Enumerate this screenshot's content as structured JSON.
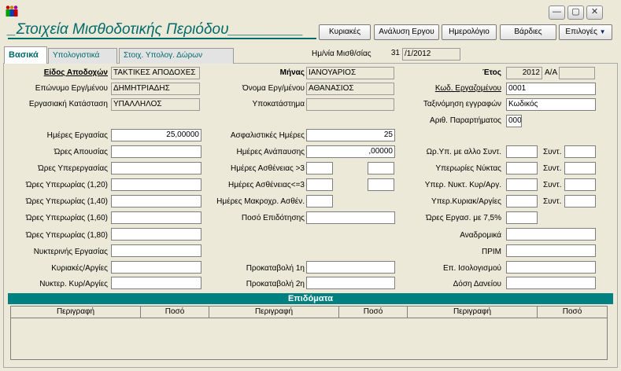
{
  "window": {
    "minimize": "—",
    "maximize": "▢",
    "close": "✕"
  },
  "title": "Στοιχεία Μισθοδοτικής Περιόδου",
  "toolbar": {
    "sundays": "Κυριακές",
    "work_analysis": "Ανάλυση Εργου",
    "calendar": "Ημερολόγιο",
    "shifts": "Βάρδιες",
    "options": "Επιλογές",
    "options_arrow": "▼"
  },
  "tabs": [
    "Βασικά",
    "Υπολογιστικά",
    "Στοιχ. Υπολογ. Δώρων"
  ],
  "payroll_date": {
    "label": "Ημ/νία Μισθ/σίας",
    "day": "31",
    "rest": "/1/2012"
  },
  "fields": {
    "earnings_type": {
      "label": "Είδος Αποδοχών",
      "value": "ΤΑΚΤΙΚΕΣ ΑΠΟΔΟΧΕΣ"
    },
    "month": {
      "label": "Μήνας",
      "value": "ΙΑΝΟΥΑΡΙΟΣ"
    },
    "year": {
      "label": "Έτος",
      "value": "2012"
    },
    "aa": {
      "label": "Α/Α",
      "value": ""
    },
    "surname": {
      "label": "Επώνυμο Εργ/μένου",
      "value": "ΔΗΜΗΤΡΙΑΔΗΣ"
    },
    "first_name": {
      "label": "Όνομα Εργ/μένου",
      "value": "ΑΘΑΝΑΣΙΟΣ"
    },
    "employee_code": {
      "label": "Κωδ. Εργαζομένου",
      "value": "0001"
    },
    "work_status": {
      "label": "Εργασιακή Κατάσταση",
      "value": "ΥΠΑΛΛΗΛΟΣ"
    },
    "branch": {
      "label": "Υποκατάστημα",
      "value": ""
    },
    "record_sort": {
      "label": "Ταξινόμηση εγγραφών",
      "value": "Κωδικός"
    },
    "annex_no": {
      "label": "Αριθ. Παραρτήματος",
      "value": "000"
    },
    "work_days": {
      "label": "Ημέρες Εργασίας",
      "value": "25,00000"
    },
    "insurance_days": {
      "label": "Ασφαλιστικές Ημέρες",
      "value": "25"
    },
    "absence_hours": {
      "label": "Ώρες Απουσίας",
      "value": ""
    },
    "rest_days": {
      "label": "Ημέρες Ανάπαυσης",
      "value": ",00000"
    },
    "overtime_other": {
      "label": "Ωρ.Υπ. με αλλο Συντ.",
      "value": ""
    },
    "overtime_work": {
      "label": "Ώρες Υπερεργασίας",
      "value": ""
    },
    "sick_gt3": {
      "label": "Ημέρες Ασθένειας >3",
      "value": ""
    },
    "night_overtime": {
      "label": "Υπερωρίες Νύκτας",
      "value": ""
    },
    "overtime_120": {
      "label": "Ώρες Υπερωρίας (1,20)",
      "value": ""
    },
    "sick_le3": {
      "label": "Ημέρες Ασθένειας<=3",
      "value": ""
    },
    "night_sun_overtime": {
      "label": "Υπερ. Νυκτ. Κυρ/Αργ.",
      "value": ""
    },
    "overtime_140": {
      "label": "Ώρες Υπερωρίας (1,40)",
      "value": ""
    },
    "long_sick": {
      "label": "Ημέρες Μακροχρ. Ασθέν.",
      "value": ""
    },
    "sun_holiday_overtime": {
      "label": "Υπερ.Κυριακ/Αργίες",
      "value": ""
    },
    "overtime_160": {
      "label": "Ώρες Υπερωρίας (1,60)",
      "value": ""
    },
    "subsidy_amount": {
      "label": "Ποσό Επιδότησης",
      "value": ""
    },
    "work_hours_75": {
      "label": "Ώρες Εργασ. με 7,5%",
      "value": ""
    },
    "overtime_180": {
      "label": "Ώρες Υπερωρίας (1,80)",
      "value": ""
    },
    "retroactive": {
      "label": "Αναδρομικά",
      "value": ""
    },
    "night_work": {
      "label": "Νυκτερινής Εργασίας",
      "value": ""
    },
    "prim": {
      "label": "ΠΡΙΜ",
      "value": ""
    },
    "sun_holidays": {
      "label": "Κυριακές/Αργίες",
      "value": ""
    },
    "advance1": {
      "label": "Προκαταβολή 1η",
      "value": ""
    },
    "balance_allowance": {
      "label": "Επ. Ισολογισμού",
      "value": ""
    },
    "night_sun_holidays": {
      "label": "Νυκτερ. Κυρ/Αργίες",
      "value": ""
    },
    "advance2": {
      "label": "Προκαταβολή 2η",
      "value": ""
    },
    "loan_installment": {
      "label": "Δόση Δανείου",
      "value": ""
    },
    "synt": "Συντ."
  },
  "allowances": {
    "title": "Επιδόματα",
    "columns": [
      "Περιγραφή",
      "Ποσό",
      "Περιγραφή",
      "Ποσό",
      "Περιγραφή",
      "Ποσό"
    ]
  },
  "colors": {
    "accent": "#008080",
    "title": "#006b6b",
    "background": "#ece9d8"
  }
}
